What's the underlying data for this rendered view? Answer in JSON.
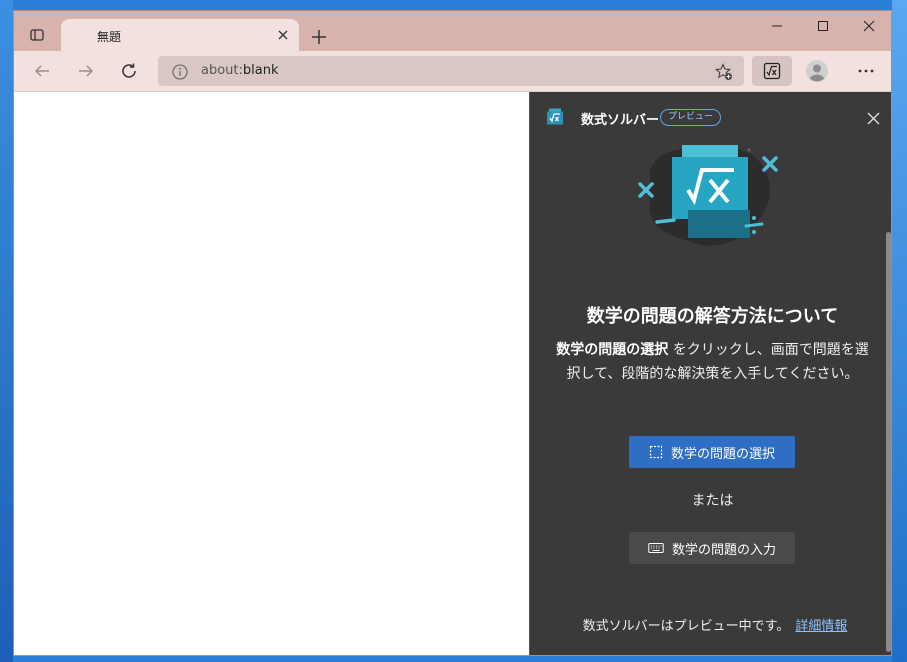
{
  "tab": {
    "title": "無題"
  },
  "address": {
    "scheme": "about:",
    "host": "blank"
  },
  "pane": {
    "title": "数式ソルバー",
    "badge": "プレビュー",
    "heading": "数学の問題の解答方法について",
    "desc_bold": "数学の問題の選択",
    "desc_rest": " をクリックし、画面で問題を選択して、段階的な解決策を入手してください。",
    "select_button": "数学の問題の選択",
    "or_text": "または",
    "input_button": "数学の問題の入力",
    "footer_text": "数式ソルバーはプレビュー中です。",
    "footer_link": "詳細情報"
  },
  "colors": {
    "titlebar": "#d8b2ac",
    "toolbar": "#f2e1de",
    "pane_bg": "#3a3a3a",
    "accent": "#2f6fc3",
    "link": "#8cc1ff"
  },
  "icons": [
    "tab-actions-icon",
    "close-icon",
    "plus-icon",
    "minimize-icon",
    "maximize-icon",
    "back-icon",
    "forward-icon",
    "refresh-icon",
    "info-icon",
    "favorite-add-icon",
    "math-solver-icon",
    "profile-icon",
    "more-icon",
    "select-region-icon",
    "keyboard-icon"
  ]
}
